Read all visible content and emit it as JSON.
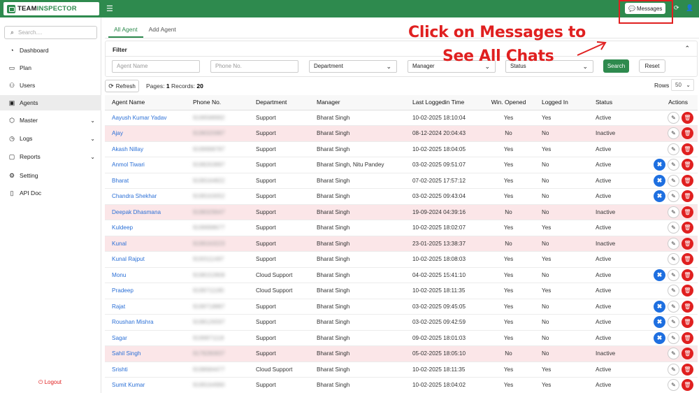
{
  "brand": {
    "name_part1": "TEAM",
    "name_part2": "INSPECTOR"
  },
  "topbar": {
    "messages_label": "Messages"
  },
  "sidebar": {
    "search_placeholder": "Search....",
    "items": [
      {
        "label": "Dashboard",
        "icon": "gauge-icon"
      },
      {
        "label": "Plan",
        "icon": "clipboard-icon"
      },
      {
        "label": "Users",
        "icon": "users-icon"
      },
      {
        "label": "Agents",
        "icon": "id-card-icon"
      },
      {
        "label": "Master",
        "icon": "cube-icon"
      },
      {
        "label": "Logs",
        "icon": "clock-icon"
      },
      {
        "label": "Reports",
        "icon": "chat-icon"
      },
      {
        "label": "Setting",
        "icon": "gear-icon"
      },
      {
        "label": "API Doc",
        "icon": "document-icon"
      }
    ],
    "logout_label": "Logout"
  },
  "tabs": {
    "all": "All Agent",
    "add": "Add Agent"
  },
  "filter": {
    "title": "Filter",
    "agent_name_placeholder": "Agent Name",
    "phone_placeholder": "Phone No.",
    "department_value": "Department",
    "manager_value": "Manager",
    "status_value": "Status",
    "search_label": "Search",
    "reset_label": "Reset"
  },
  "annotation": {
    "line1": "Click on Messages to",
    "line2": "See All Chats"
  },
  "toolbar": {
    "refresh_label": "Refresh",
    "pages_label": "Pages:",
    "pages_value": "1",
    "records_label": "Records:",
    "records_value": "20",
    "rows_label": "Rows",
    "rows_value": "50"
  },
  "table": {
    "headers": {
      "agent_name": "Agent Name",
      "phone": "Phone No.",
      "department": "Department",
      "manager": "Manager",
      "last_login": "Last Loggedin Time",
      "win_opened": "Win. Opened",
      "logged_in": "Logged In",
      "status": "Status",
      "actions": "Actions"
    },
    "rows": [
      {
        "name": "Aayush Kumar Yadav",
        "phone": "9199588992",
        "dept": "Support",
        "manager": "Bharat Singh",
        "login": "10-02-2025 18:10:04",
        "win": "Yes",
        "logged": "Yes",
        "status": "Active",
        "chat": false
      },
      {
        "name": "Ajay",
        "phone": "9198320987",
        "dept": "Support",
        "manager": "Bharat Singh",
        "login": "08-12-2024 20:04:43",
        "win": "No",
        "logged": "No",
        "status": "Inactive",
        "chat": false
      },
      {
        "name": "Akash Nillay",
        "phone": "9199998787",
        "dept": "Support",
        "manager": "Bharat Singh",
        "login": "10-02-2025 18:04:05",
        "win": "Yes",
        "logged": "Yes",
        "status": "Active",
        "chat": false
      },
      {
        "name": "Anmol Tiwari",
        "phone": "9198263897",
        "dept": "Support",
        "manager": "Bharat Singh, Nitu Pandey",
        "login": "03-02-2025 09:51:07",
        "win": "Yes",
        "logged": "No",
        "status": "Active",
        "chat": true
      },
      {
        "name": "Bharat",
        "phone": "9199164822",
        "dept": "Support",
        "manager": "Bharat Singh",
        "login": "07-02-2025 17:57:12",
        "win": "Yes",
        "logged": "No",
        "status": "Active",
        "chat": true
      },
      {
        "name": "Chandra Shekhar",
        "phone": "9199163052",
        "dept": "Support",
        "manager": "Bharat Singh",
        "login": "03-02-2025 09:43:04",
        "win": "Yes",
        "logged": "No",
        "status": "Active",
        "chat": true
      },
      {
        "name": "Deepak Dhasmana",
        "phone": "9198329647",
        "dept": "Support",
        "manager": "Bharat Singh",
        "login": "19-09-2024 04:39:16",
        "win": "No",
        "logged": "No",
        "status": "Inactive",
        "chat": false
      },
      {
        "name": "Kuldeep",
        "phone": "9199998677",
        "dept": "Support",
        "manager": "Bharat Singh",
        "login": "10-02-2025 18:02:07",
        "win": "Yes",
        "logged": "Yes",
        "status": "Active",
        "chat": false
      },
      {
        "name": "Kunal",
        "phone": "9199163223",
        "dept": "Support",
        "manager": "Bharat Singh",
        "login": "23-01-2025 13:38:37",
        "win": "No",
        "logged": "No",
        "status": "Inactive",
        "chat": false
      },
      {
        "name": "Kunal Rajput",
        "phone": "9193111497",
        "dept": "Support",
        "manager": "Bharat Singh",
        "login": "10-02-2025 18:08:03",
        "win": "Yes",
        "logged": "Yes",
        "status": "Active",
        "chat": false
      },
      {
        "name": "Monu",
        "phone": "9198152808",
        "dept": "Cloud Support",
        "manager": "Bharat Singh",
        "login": "04-02-2025 15:41:10",
        "win": "Yes",
        "logged": "No",
        "status": "Active",
        "chat": true
      },
      {
        "name": "Pradeep",
        "phone": "9199711180",
        "dept": "Cloud Support",
        "manager": "Bharat Singh",
        "login": "10-02-2025 18:11:35",
        "win": "Yes",
        "logged": "Yes",
        "status": "Active",
        "chat": false
      },
      {
        "name": "Rajat",
        "phone": "9199718887",
        "dept": "Support",
        "manager": "Bharat Singh",
        "login": "03-02-2025 09:45:05",
        "win": "Yes",
        "logged": "No",
        "status": "Active",
        "chat": true
      },
      {
        "name": "Roushan Mishra",
        "phone": "9198126597",
        "dept": "Support",
        "manager": "Bharat Singh",
        "login": "03-02-2025 09:42:59",
        "win": "Yes",
        "logged": "No",
        "status": "Active",
        "chat": true
      },
      {
        "name": "Sagar",
        "phone": "9199871118",
        "dept": "Support",
        "manager": "Bharat Singh",
        "login": "09-02-2025 18:01:03",
        "win": "Yes",
        "logged": "No",
        "status": "Active",
        "chat": true
      },
      {
        "name": "Sahil Singh",
        "phone": "9178280837",
        "dept": "Support",
        "manager": "Bharat Singh",
        "login": "05-02-2025 18:05:10",
        "win": "No",
        "logged": "No",
        "status": "Inactive",
        "chat": false
      },
      {
        "name": "Srishti",
        "phone": "9198684477",
        "dept": "Cloud Support",
        "manager": "Bharat Singh",
        "login": "10-02-2025 18:11:35",
        "win": "Yes",
        "logged": "Yes",
        "status": "Active",
        "chat": false
      },
      {
        "name": "Sumit Kumar",
        "phone": "9199164990",
        "dept": "Support",
        "manager": "Bharat Singh",
        "login": "10-02-2025 18:04:02",
        "win": "Yes",
        "logged": "Yes",
        "status": "Active",
        "chat": false
      }
    ]
  },
  "colors": {
    "brand_green": "#2e8a4e",
    "inactive_row": "#fbe6e8",
    "annotation_red": "#e02020",
    "link_blue": "#2a6fd6"
  }
}
